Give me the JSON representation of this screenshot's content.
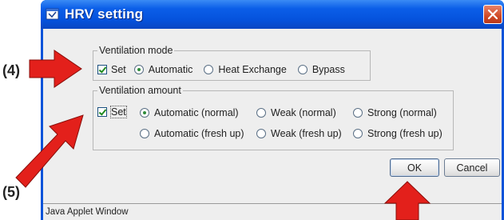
{
  "window": {
    "title": "HRV setting",
    "status_text": "Java Applet Window"
  },
  "ventilation_mode": {
    "legend": "Ventilation mode",
    "set_label": "Set",
    "set_checked": true,
    "options": [
      {
        "label": "Automatic",
        "selected": true
      },
      {
        "label": "Heat Exchange",
        "selected": false
      },
      {
        "label": "Bypass",
        "selected": false
      }
    ]
  },
  "ventilation_amount": {
    "legend": "Ventilation amount",
    "set_label": "Set",
    "set_checked": true,
    "options": [
      {
        "label": "Automatic (normal)",
        "selected": true
      },
      {
        "label": "Weak (normal)",
        "selected": false
      },
      {
        "label": "Strong (normal)",
        "selected": false
      },
      {
        "label": "Automatic (fresh up)",
        "selected": false
      },
      {
        "label": "Weak (fresh up)",
        "selected": false
      },
      {
        "label": "Strong (fresh up)",
        "selected": false
      }
    ]
  },
  "buttons": {
    "ok_label": "OK",
    "cancel_label": "Cancel"
  },
  "annotations": {
    "label_4": "(4)",
    "label_5": "(5)",
    "arrow_color": "#e3201b"
  },
  "icons": {
    "title_icon": "applet-icon",
    "close_icon": "close-icon"
  }
}
